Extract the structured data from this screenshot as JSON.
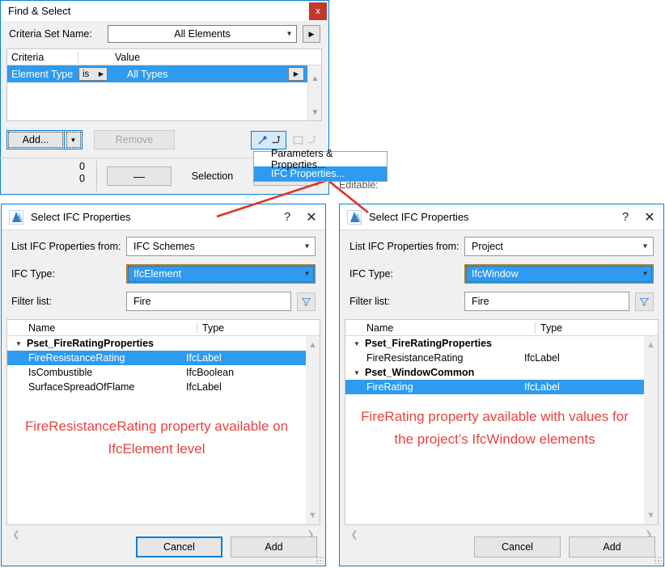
{
  "find_select": {
    "title": "Find & Select",
    "close_label": "x",
    "criteria_set_label": "Criteria Set Name:",
    "criteria_set_value": "All Elements",
    "criteria_set_more": "▶",
    "table": {
      "headers": [
        "Criteria",
        "",
        "Value"
      ],
      "rows": [
        {
          "criteria": "Element Type",
          "operator": "is",
          "value": "All Types"
        }
      ]
    },
    "add_label": "Add...",
    "add_arrow": "▼",
    "remove_label": "Remove",
    "counts": {
      "line1": "0",
      "line2": "0",
      "hidden_label": "Editable:"
    },
    "selection_label": "Selection",
    "minus_label": "—",
    "plus_label": "+",
    "tool_pick_icon": "eyedropper-icon",
    "tool_marquee_icon": "marquee-icon"
  },
  "context_menu": {
    "items": [
      {
        "label": "Parameters & Properties...",
        "selected": false
      },
      {
        "label": "IFC Properties...",
        "selected": true
      }
    ]
  },
  "ifc_left": {
    "title": "Select IFC Properties",
    "help_label": "?",
    "close_label": "✕",
    "list_from_label": "List IFC Properties from:",
    "list_from_value": "IFC Schemes",
    "ifc_type_label": "IFC Type:",
    "ifc_type_value": "IfcElement",
    "filter_label": "Filter list:",
    "filter_value": "Fire",
    "columns": [
      "Name",
      "Type"
    ],
    "groups": [
      {
        "name": "Pset_FireRatingProperties",
        "items": [
          {
            "name": "FireResistanceRating",
            "type": "IfcLabel",
            "selected": true
          },
          {
            "name": "IsCombustible",
            "type": "IfcBoolean",
            "selected": false
          },
          {
            "name": "SurfaceSpreadOfFlame",
            "type": "IfcLabel",
            "selected": false
          }
        ]
      }
    ],
    "annotation": "FireResistanceRating property available on IfcElement level",
    "cancel_label": "Cancel",
    "add_label": "Add",
    "cancel_focused": true
  },
  "ifc_right": {
    "title": "Select IFC Properties",
    "help_label": "?",
    "close_label": "✕",
    "list_from_label": "List IFC Properties from:",
    "list_from_value": "Project",
    "ifc_type_label": "IFC Type:",
    "ifc_type_value": "IfcWindow",
    "filter_label": "Filter list:",
    "filter_value": "Fire",
    "columns": [
      "Name",
      "Type"
    ],
    "groups": [
      {
        "name": "Pset_FireRatingProperties",
        "items": [
          {
            "name": "FireResistanceRating",
            "type": "IfcLabel",
            "selected": false
          }
        ]
      },
      {
        "name": "Pset_WindowCommon",
        "items": [
          {
            "name": "FireRating",
            "type": "IfcLabel",
            "selected": true
          }
        ]
      }
    ],
    "annotation": "FireRating property available with values for the project’s IfcWindow elements",
    "cancel_label": "Cancel",
    "add_label": "Add",
    "cancel_focused": false
  },
  "colors": {
    "accent_blue": "#2e9bf0",
    "window_border": "#0a7fd4",
    "annotation_red": "#e8423f",
    "close_red": "#c0392b",
    "dialog_bg": "#f0f0f0"
  }
}
